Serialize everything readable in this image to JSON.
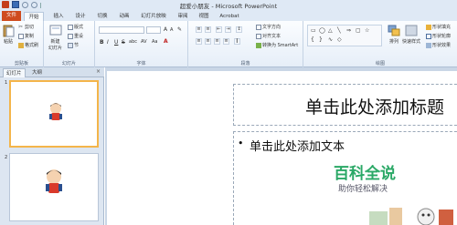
{
  "window": {
    "title": "超爱小朋友 - Microsoft PowerPoint"
  },
  "tabs": [
    {
      "label": "文件"
    },
    {
      "label": "开始"
    },
    {
      "label": "插入"
    },
    {
      "label": "设计"
    },
    {
      "label": "切换"
    },
    {
      "label": "动画"
    },
    {
      "label": "幻灯片放映"
    },
    {
      "label": "审阅"
    },
    {
      "label": "视图"
    },
    {
      "label": "Acrobat"
    }
  ],
  "ribbon": {
    "clipboard": {
      "label": "剪贴板",
      "paste": "粘贴",
      "cut": "剪切",
      "copy": "复制",
      "format_painter": "格式刷"
    },
    "slides": {
      "label": "幻灯片",
      "new_slide": "新建",
      "new_slide2": "幻灯片",
      "layout": "版式",
      "reset": "重设",
      "section": "节"
    },
    "font": {
      "label": "字体",
      "size": "",
      "bold": "B",
      "italic": "I",
      "underline": "U",
      "strike": "S",
      "shadow": "abc",
      "spacing": "AV",
      "case": "Aa",
      "grow": "A",
      "shrink": "A"
    },
    "paragraph": {
      "label": "段落",
      "text_direction": "文字方向",
      "align_text": "对齐文本",
      "smartart": "转换为 SmartArt"
    },
    "drawing": {
      "label": "绘图",
      "arrange": "排列",
      "quick_styles": "快速样式",
      "fill": "形状填充",
      "outline": "形状轮廓",
      "effects": "形状效果"
    }
  },
  "left_pane": {
    "tabs": [
      {
        "label": "幻灯片"
      },
      {
        "label": "大纲"
      }
    ],
    "close": "×",
    "thumbnails": [
      {
        "number": "1"
      },
      {
        "number": "2"
      }
    ]
  },
  "slide": {
    "title_placeholder": "单击此处添加标题",
    "body_bullet": "•",
    "body_placeholder": "单击此处添加文本"
  },
  "watermark": {
    "title": "百科全说",
    "subtitle": "助你轻松解决"
  }
}
